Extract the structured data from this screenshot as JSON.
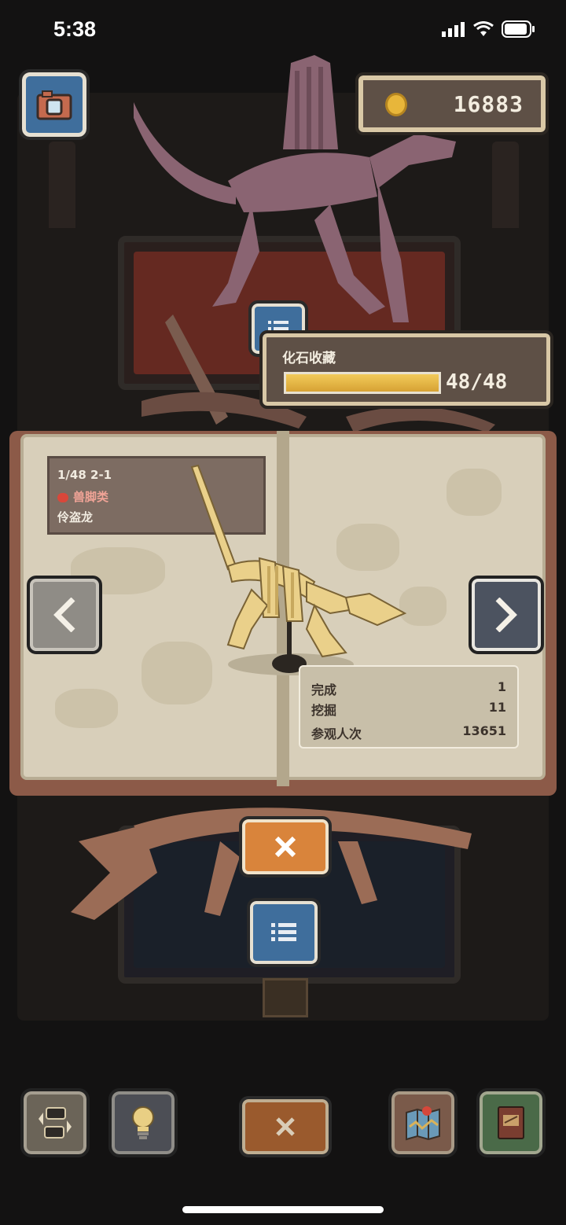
{
  "status_bar": {
    "time": "5:38"
  },
  "currency": {
    "coins": "16883"
  },
  "collection": {
    "title": "化石收藏",
    "count_text": "48/48",
    "progress": 1.0
  },
  "fossil": {
    "page_line": "1/48 2-1",
    "category": "兽脚类",
    "name": "伶盗龙",
    "category_color": "#d9473a"
  },
  "stats": [
    {
      "label": "完成",
      "value": "1"
    },
    {
      "label": "挖掘",
      "value": "11"
    },
    {
      "label": "参观人次",
      "value": "13651"
    }
  ],
  "icons": {
    "camera": "camera-icon",
    "coin": "coin-icon",
    "list": "list-icon",
    "prev": "chevron-left-icon",
    "next": "chevron-right-icon",
    "close": "close-icon",
    "swap": "swap-icon",
    "bulb": "lightbulb-icon",
    "map": "map-icon",
    "book": "book-icon"
  },
  "colors": {
    "accent_orange": "#d9843b",
    "accent_blue": "#3f6e9c",
    "panel_brown": "#5e5046",
    "bar_gold": "#e1b13f"
  }
}
